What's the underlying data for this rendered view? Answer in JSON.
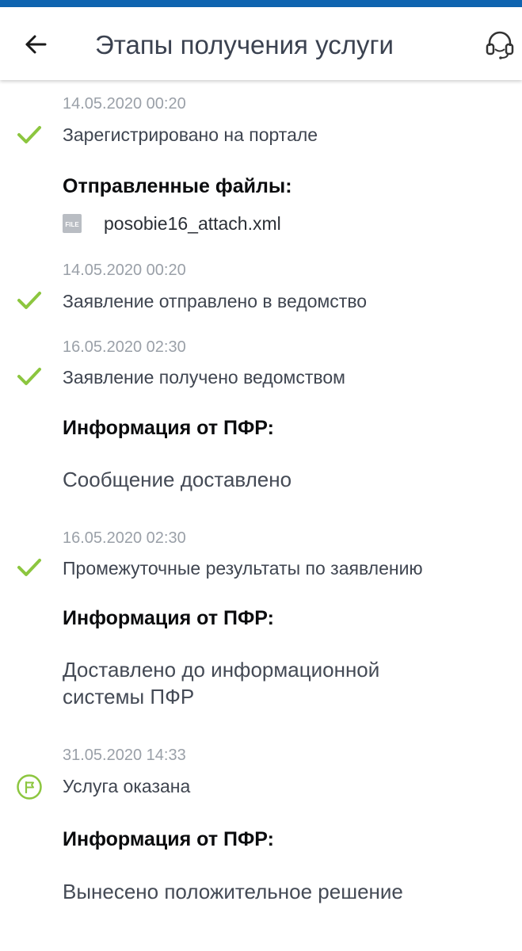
{
  "app_bar": {
    "title": "Этапы получения услуги",
    "back_icon": "arrow-left-icon",
    "support_icon": "headset-icon"
  },
  "colors": {
    "accent_blue": "#0f64b0",
    "check_green": "#8cc63f"
  },
  "timeline": {
    "step1": {
      "date": "14.05.2020 00:20",
      "title": "Зарегистрировано на портале",
      "files_heading": "Отправленные файлы:",
      "file_badge": "FILE",
      "file_name": "posobie16_attach.xml"
    },
    "step2": {
      "date": "14.05.2020 00:20",
      "title": "Заявление отправлено в ведомство"
    },
    "step3": {
      "date": "16.05.2020 02:30",
      "title": "Заявление получено ведомством",
      "info_heading": "Информация от ПФР:",
      "info_text": "Сообщение доставлено"
    },
    "step4": {
      "date": "16.05.2020 02:30",
      "title": "Промежуточные результаты по заявлению",
      "info_heading": "Информация от ПФР:",
      "info_text": "Доставлено до информационной системы ПФР"
    },
    "step5": {
      "date": "31.05.2020 14:33",
      "title": "Услуга оказана",
      "info_heading": "Информация от ПФР:",
      "info_text": "Вынесено положительное решение"
    }
  }
}
